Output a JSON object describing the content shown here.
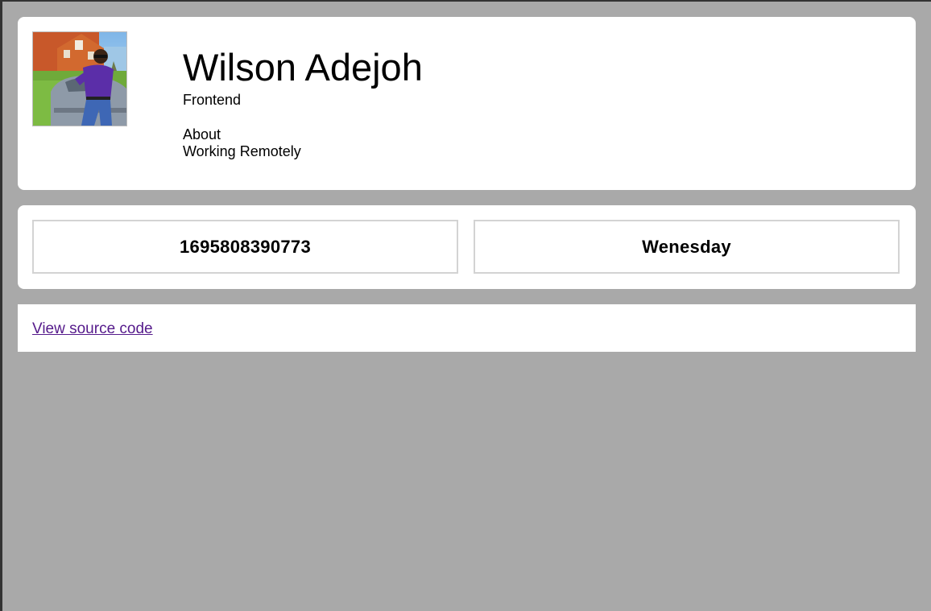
{
  "profile": {
    "name": "Wilson Adejoh",
    "role": "Frontend",
    "about_title": "About",
    "about_text": "Working Remotely"
  },
  "stats": {
    "current_time_ms": "1695808390773",
    "current_day": "Wenesday"
  },
  "footer": {
    "source_link_label": "View source code"
  },
  "colors": {
    "page_background": "#a9a9a9",
    "card_background": "#ffffff",
    "link": "#551a8b",
    "stat_border": "#d3d3d3"
  }
}
